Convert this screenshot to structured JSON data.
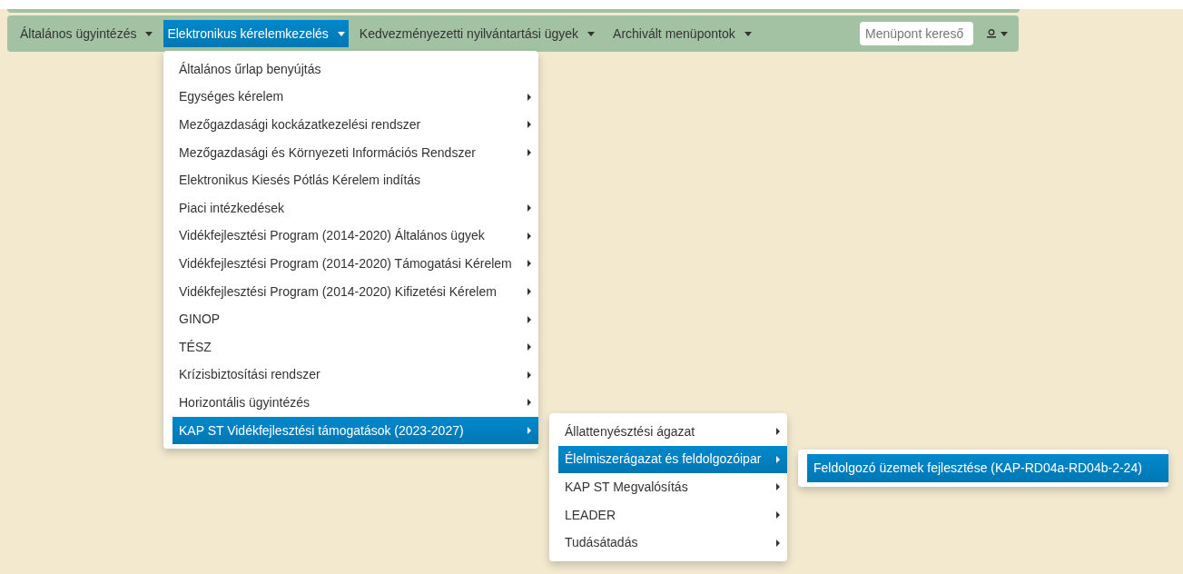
{
  "navbar": {
    "items": [
      {
        "label": "Általános ügyintézés",
        "selected": false
      },
      {
        "label": "Elektronikus kérelemkezelés",
        "selected": true
      },
      {
        "label": "Kedvezményezetti nyilvántartási ügyek",
        "selected": false
      },
      {
        "label": "Archivált menüpontok",
        "selected": false
      }
    ],
    "search": {
      "placeholder": "Menüpont kereső"
    }
  },
  "menus": [
    {
      "items": [
        {
          "label": "Általános űrlap benyújtás",
          "selected": false,
          "has_submenu": false
        },
        {
          "label": "Egységes kérelem",
          "selected": false,
          "has_submenu": true
        },
        {
          "label": "Mezőgazdasági kockázatkezelési rendszer",
          "selected": false,
          "has_submenu": true
        },
        {
          "label": "Mezőgazdasági és Környezeti Információs Rendszer",
          "selected": false,
          "has_submenu": true
        },
        {
          "label": "Elektronikus Kiesés Pótlás Kérelem indítás",
          "selected": false,
          "has_submenu": false
        },
        {
          "label": "Piaci intézkedések",
          "selected": false,
          "has_submenu": true
        },
        {
          "label": "Vidékfejlesztési Program (2014-2020) Általános ügyek",
          "selected": false,
          "has_submenu": true
        },
        {
          "label": "Vidékfejlesztési Program (2014-2020) Támogatási Kérelem",
          "selected": false,
          "has_submenu": true
        },
        {
          "label": "Vidékfejlesztési Program (2014-2020) Kifizetési Kérelem",
          "selected": false,
          "has_submenu": true
        },
        {
          "label": "GINOP",
          "selected": false,
          "has_submenu": true
        },
        {
          "label": "TÉSZ",
          "selected": false,
          "has_submenu": true
        },
        {
          "label": "Krízisbiztosítási rendszer",
          "selected": false,
          "has_submenu": true
        },
        {
          "label": "Horizontális ügyintézés",
          "selected": false,
          "has_submenu": true
        },
        {
          "label": "KAP ST Vidékfejlesztési támogatások (2023-2027)",
          "selected": true,
          "has_submenu": true
        }
      ]
    },
    {
      "items": [
        {
          "label": "Állattenyésztési ágazat",
          "selected": false,
          "has_submenu": true
        },
        {
          "label": "Élelmiszerágazat és feldolgozóipar",
          "selected": true,
          "has_submenu": true
        },
        {
          "label": "KAP ST Megvalósítás",
          "selected": false,
          "has_submenu": true
        },
        {
          "label": "LEADER",
          "selected": false,
          "has_submenu": true
        },
        {
          "label": "Tudásátadás",
          "selected": false,
          "has_submenu": true
        }
      ]
    },
    {
      "items": [
        {
          "label": "Feldolgozó üzemek fejlesztése (KAP-RD04a-RD04b-2-24)",
          "selected": true,
          "has_submenu": false
        }
      ]
    }
  ]
}
